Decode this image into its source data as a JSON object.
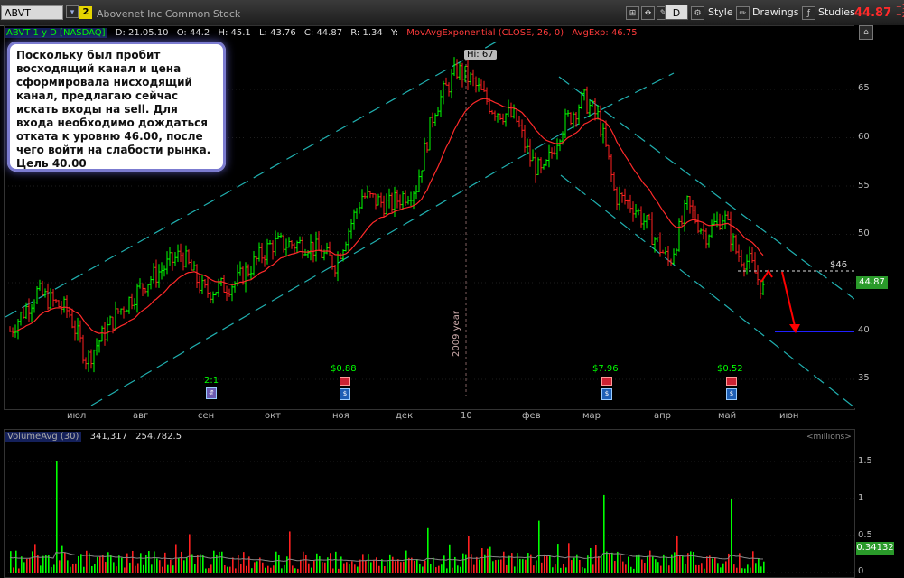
{
  "toolbar": {
    "symbol": "ABVT",
    "link_number": "2",
    "description": "Abovenet Inc Common Stock",
    "buttons": {
      "period": "D",
      "style": "Style",
      "drawings": "Drawings",
      "studies": "Studies"
    },
    "last_price": "44.87",
    "change_top": "+1",
    "change_bottom": "+2"
  },
  "chart": {
    "info": {
      "symbol_tag": "ABVT 1 y D [NASDAQ]",
      "date": "D: 21.05.10",
      "open": "O: 44.2",
      "high": "H: 45.1",
      "low": "L: 43.76",
      "close": "C: 44.87",
      "range": "R: 1.34",
      "y": "Y:",
      "study": "MovAvgExponential (CLOSE, 26, 0)",
      "study_value": "AvgExp: 46.75"
    },
    "note": "Поскольку был пробит восходящий канал и цена сформировала нисходящий канал, предлагаю сейчас искать входы на sell. Для входа необходимо дождаться отката  к уровню 46.00,  после чего войти на слабости рынка. Цель 40.00",
    "hi_label": "Hi: 67",
    "year_label": "2009 year",
    "level_label": "$46",
    "current_price_tag": "44.87",
    "y_axis": [
      "65",
      "60",
      "55",
      "50",
      "45",
      "40",
      "35"
    ],
    "x_axis": [
      "июл",
      "авг",
      "сен",
      "окт",
      "ноя",
      "дек",
      "10",
      "фев",
      "мар",
      "апр",
      "май",
      "июн"
    ],
    "events": [
      {
        "label": "2:1",
        "icon": "split-icon"
      },
      {
        "label": "$0.88",
        "icon": "dividend-icon"
      },
      {
        "label": "$7.96",
        "icon": "dividend-icon"
      },
      {
        "label": "$0.52",
        "icon": "dividend-icon"
      }
    ],
    "colors": {
      "up": "#00ff00",
      "down": "#ff2020",
      "ema": "#ff2a2a",
      "channel": "#20b0b0",
      "target": "#2020ff",
      "arrow": "#ff0000"
    }
  },
  "volume": {
    "study": "VolumeAvg (30)",
    "value1": "341,317",
    "value2": "254,782.5",
    "units": "<millions>",
    "y_axis": [
      "1.5",
      "1",
      "0.5",
      "0"
    ],
    "current_tag": "0.34132"
  }
}
